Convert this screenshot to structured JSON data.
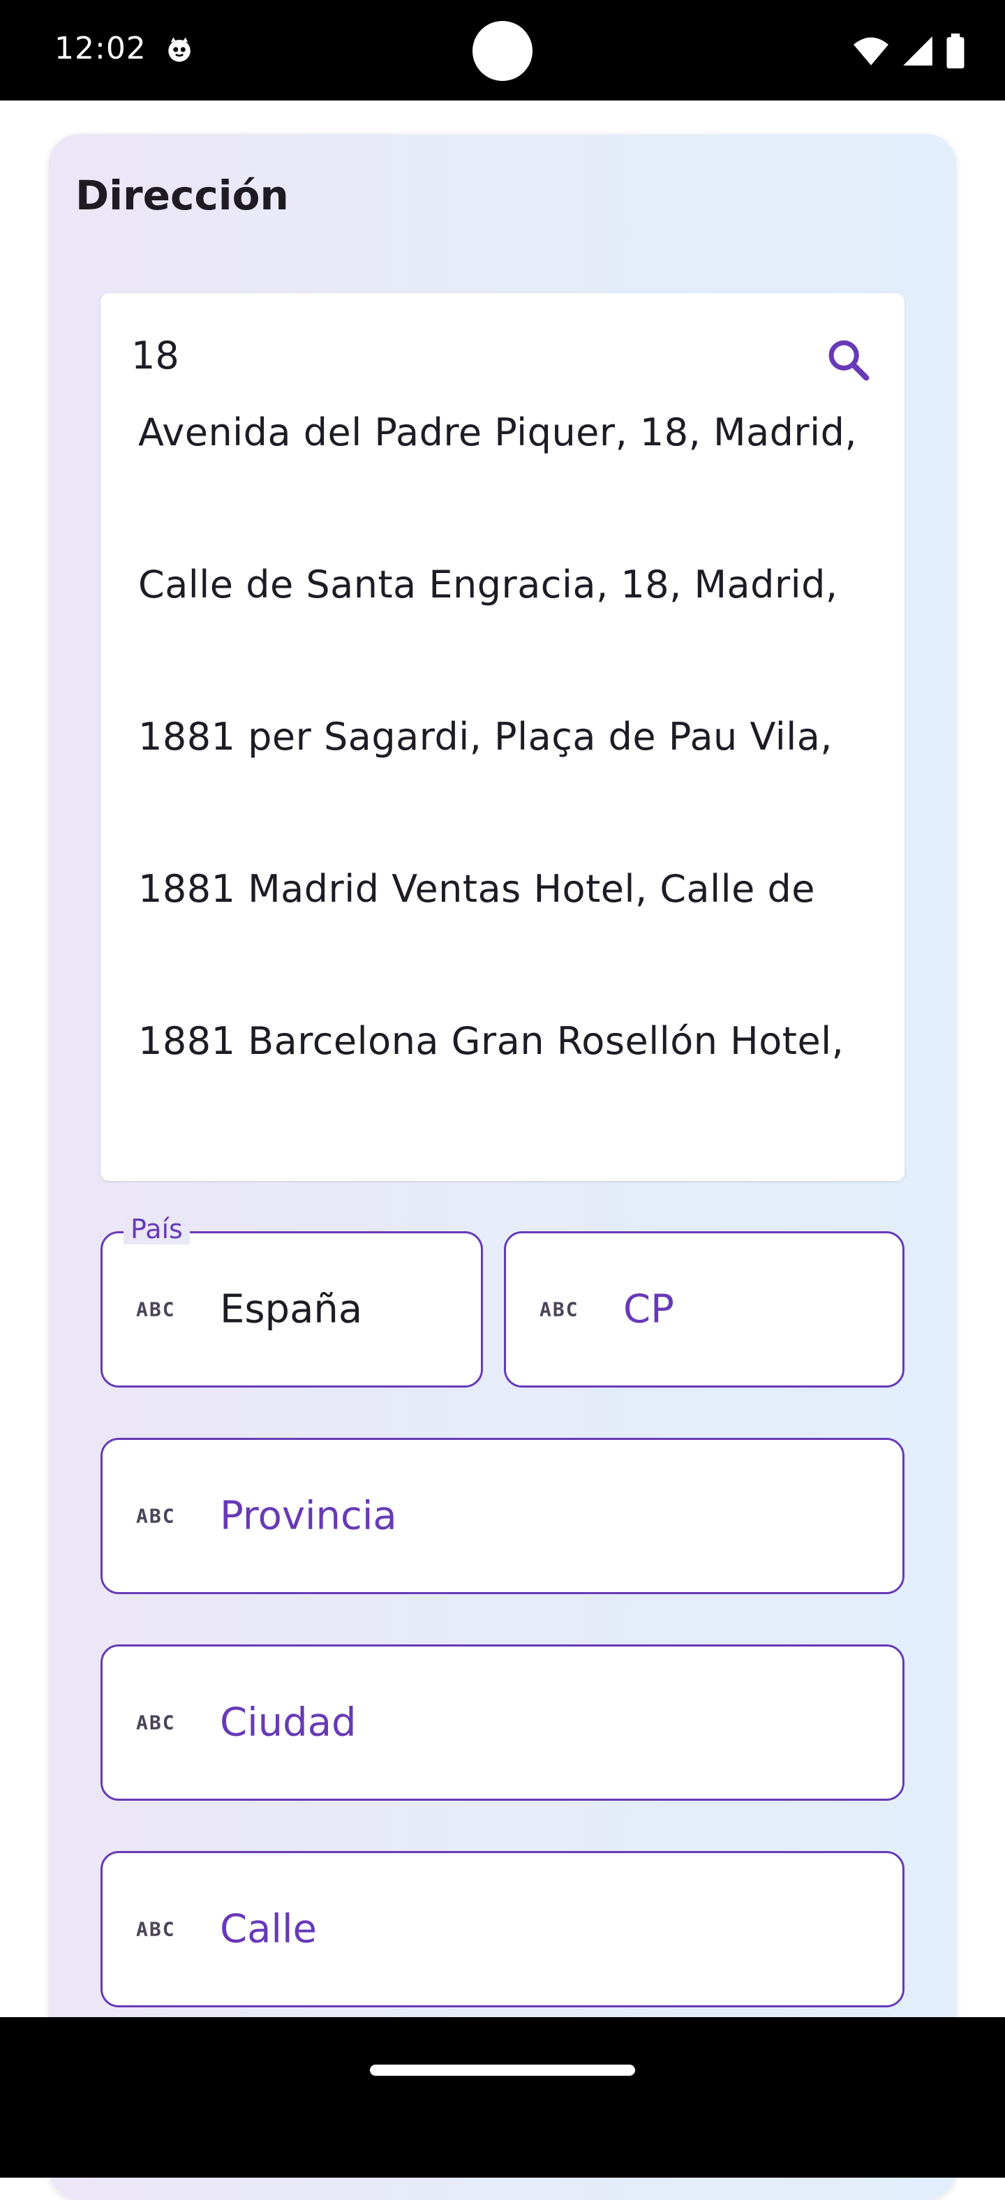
{
  "status_bar": {
    "time": "12:02"
  },
  "card": {
    "title": "Dirección"
  },
  "search": {
    "value": "18",
    "suggestions": [
      "Avenida del Padre Piquer, 18, Madrid,",
      "Calle de Santa Engracia, 18, Madrid,",
      "1881 per Sagardi, Plaça de Pau Vila,",
      "1881 Madrid Ventas Hotel, Calle de",
      "1881 Barcelona Gran Rosellón Hotel,"
    ]
  },
  "fields": {
    "pais": {
      "label": "País",
      "value": "España",
      "icon": "abc-icon"
    },
    "cp": {
      "placeholder": "CP",
      "icon": "abc-icon"
    },
    "provincia": {
      "placeholder": "Provincia",
      "icon": "abc-icon"
    },
    "ciudad": {
      "placeholder": "Ciudad",
      "icon": "abc-icon"
    },
    "calle": {
      "placeholder": "Calle",
      "icon": "abc-icon"
    }
  },
  "icon_glyph": "ABC",
  "colors": {
    "accent": "#673ab7",
    "status_bar": "#000000",
    "text": "#1f1b24"
  }
}
